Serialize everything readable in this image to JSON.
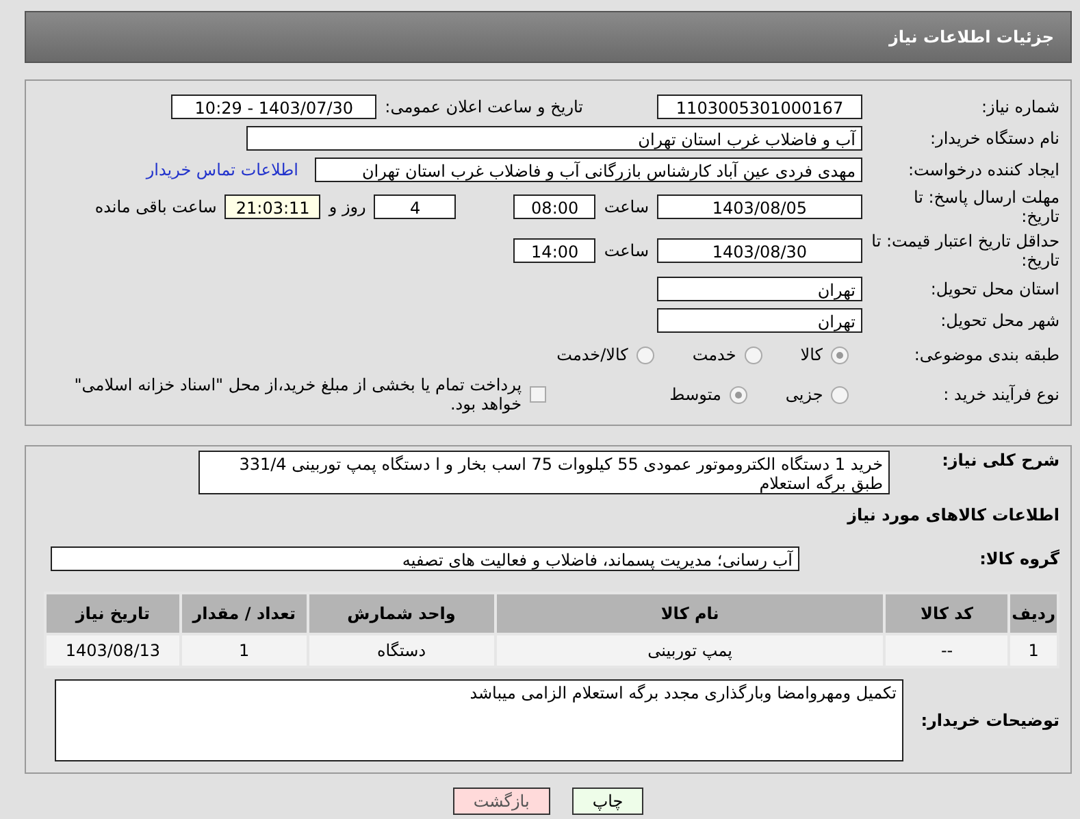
{
  "header": {
    "title": "جزئیات اطلاعات نیاز"
  },
  "need_number": {
    "label": "شماره نیاز:",
    "value": "1103005301000167"
  },
  "announce": {
    "label": "تاریخ و ساعت اعلان عمومی:",
    "value": "1403/07/30 - 10:29"
  },
  "buyer_org": {
    "label": "نام دستگاه خریدار:",
    "value": "آب و فاضلاب غرب استان تهران"
  },
  "requester": {
    "label": "ایجاد کننده درخواست:",
    "value": "مهدی فردی عین آباد کارشناس بازرگانی آب و فاضلاب غرب استان تهران",
    "link": "اطلاعات تماس خریدار"
  },
  "deadline": {
    "label": "مهلت ارسال پاسخ: تا تاریخ:",
    "date": "1403/08/05",
    "time_label": "ساعت",
    "time": "08:00",
    "days": "4",
    "days_label": "روز و",
    "remaining": "21:03:11",
    "remaining_label": "ساعت باقی مانده"
  },
  "validity": {
    "label": "حداقل تاریخ اعتبار قیمت: تا تاریخ:",
    "date": "1403/08/30",
    "time_label": "ساعت",
    "time": "14:00"
  },
  "province": {
    "label": "استان محل تحویل:",
    "value": "تهران"
  },
  "city": {
    "label": "شهر محل تحویل:",
    "value": "تهران"
  },
  "classification": {
    "label": "طبقه بندی موضوعی:",
    "options": [
      {
        "label": "کالا",
        "selected": true
      },
      {
        "label": "خدمت",
        "selected": false
      },
      {
        "label": "کالا/خدمت",
        "selected": false
      }
    ]
  },
  "process": {
    "label": "نوع فرآیند خرید :",
    "options": [
      {
        "label": "جزیی",
        "selected": false
      },
      {
        "label": "متوسط",
        "selected": true
      }
    ],
    "treasury": {
      "checked": false,
      "label": "پرداخت تمام یا بخشی از مبلغ خرید،از محل \"اسناد خزانه اسلامی\" خواهد بود."
    }
  },
  "description": {
    "label": "شرح کلی نیاز:",
    "value": "خرید 1 دستگاه الکتروموتور عمودی 55 کیلووات 75 اسب بخار و ا دستگاه پمپ توربینی 331/4 طبق برگه استعلام"
  },
  "goods_heading": "اطلاعات کالاهای مورد نیاز",
  "goods_group": {
    "label": "گروه کالا:",
    "value": "آب رسانی؛ مدیریت پسماند، فاضلاب و فعالیت های تصفیه"
  },
  "table": {
    "columns": [
      "ردیف",
      "کد کالا",
      "نام کالا",
      "واحد شمارش",
      "تعداد / مقدار",
      "تاریخ نیاز"
    ],
    "rows": [
      [
        "1",
        "--",
        "پمپ توربینی",
        "دستگاه",
        "1",
        "1403/08/13"
      ]
    ]
  },
  "buyer_notes": {
    "label": "توضیحات خریدار:",
    "value": "تکمیل ومهروامضا وبارگذاری مجدد برگه استعلام الزامی میباشد"
  },
  "buttons": [
    {
      "label": "چاپ",
      "kind": "print"
    },
    {
      "label": "بازگشت",
      "kind": "back"
    }
  ]
}
